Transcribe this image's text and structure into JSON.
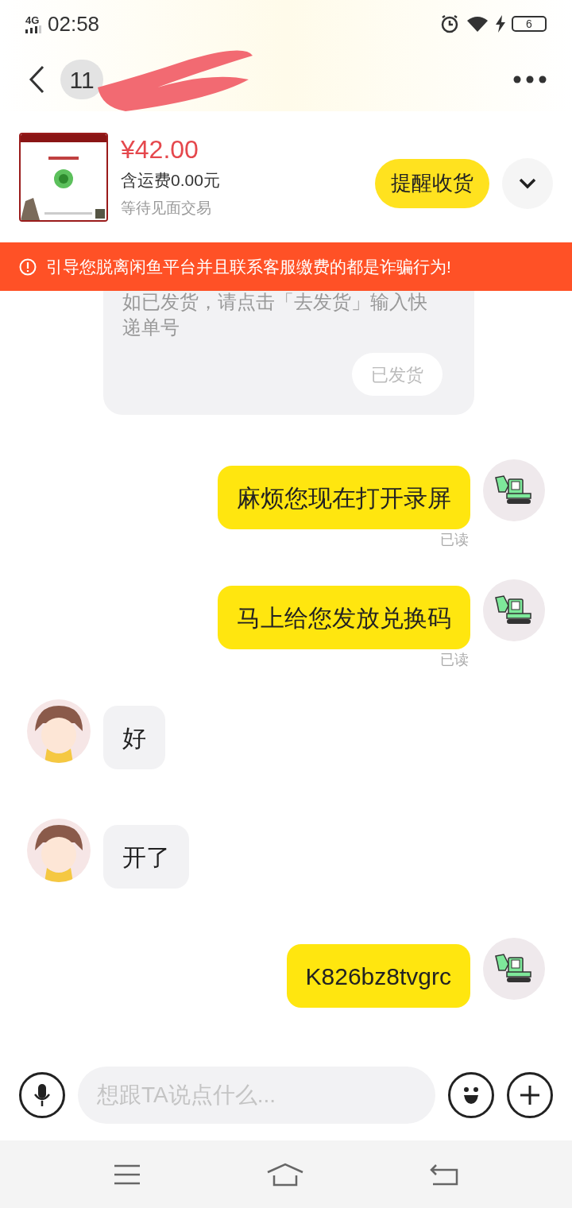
{
  "status_bar": {
    "network": "4G",
    "time": "02:58",
    "battery": "6"
  },
  "header": {
    "unread_count": "11"
  },
  "order": {
    "price": "¥42.00",
    "shipping": "含运费0.00元",
    "status": "等待见面交易",
    "action": "提醒收货"
  },
  "warning": "引导您脱离闲鱼平台并且联系客服缴费的都是诈骗行为!",
  "messages": [
    {
      "kind": "system",
      "text": "如已发货，请点击「去发货」输入快递单号",
      "button": "已发货"
    },
    {
      "kind": "sent",
      "text": "麻烦您现在打开录屏",
      "receipt": "已读"
    },
    {
      "kind": "sent",
      "text": "马上给您发放兑换码",
      "receipt": "已读"
    },
    {
      "kind": "received",
      "text": "好"
    },
    {
      "kind": "received",
      "text": "开了"
    },
    {
      "kind": "sent",
      "text": "K826bz8tvgrc"
    }
  ],
  "composer": {
    "placeholder": "想跟TA说点什么..."
  }
}
